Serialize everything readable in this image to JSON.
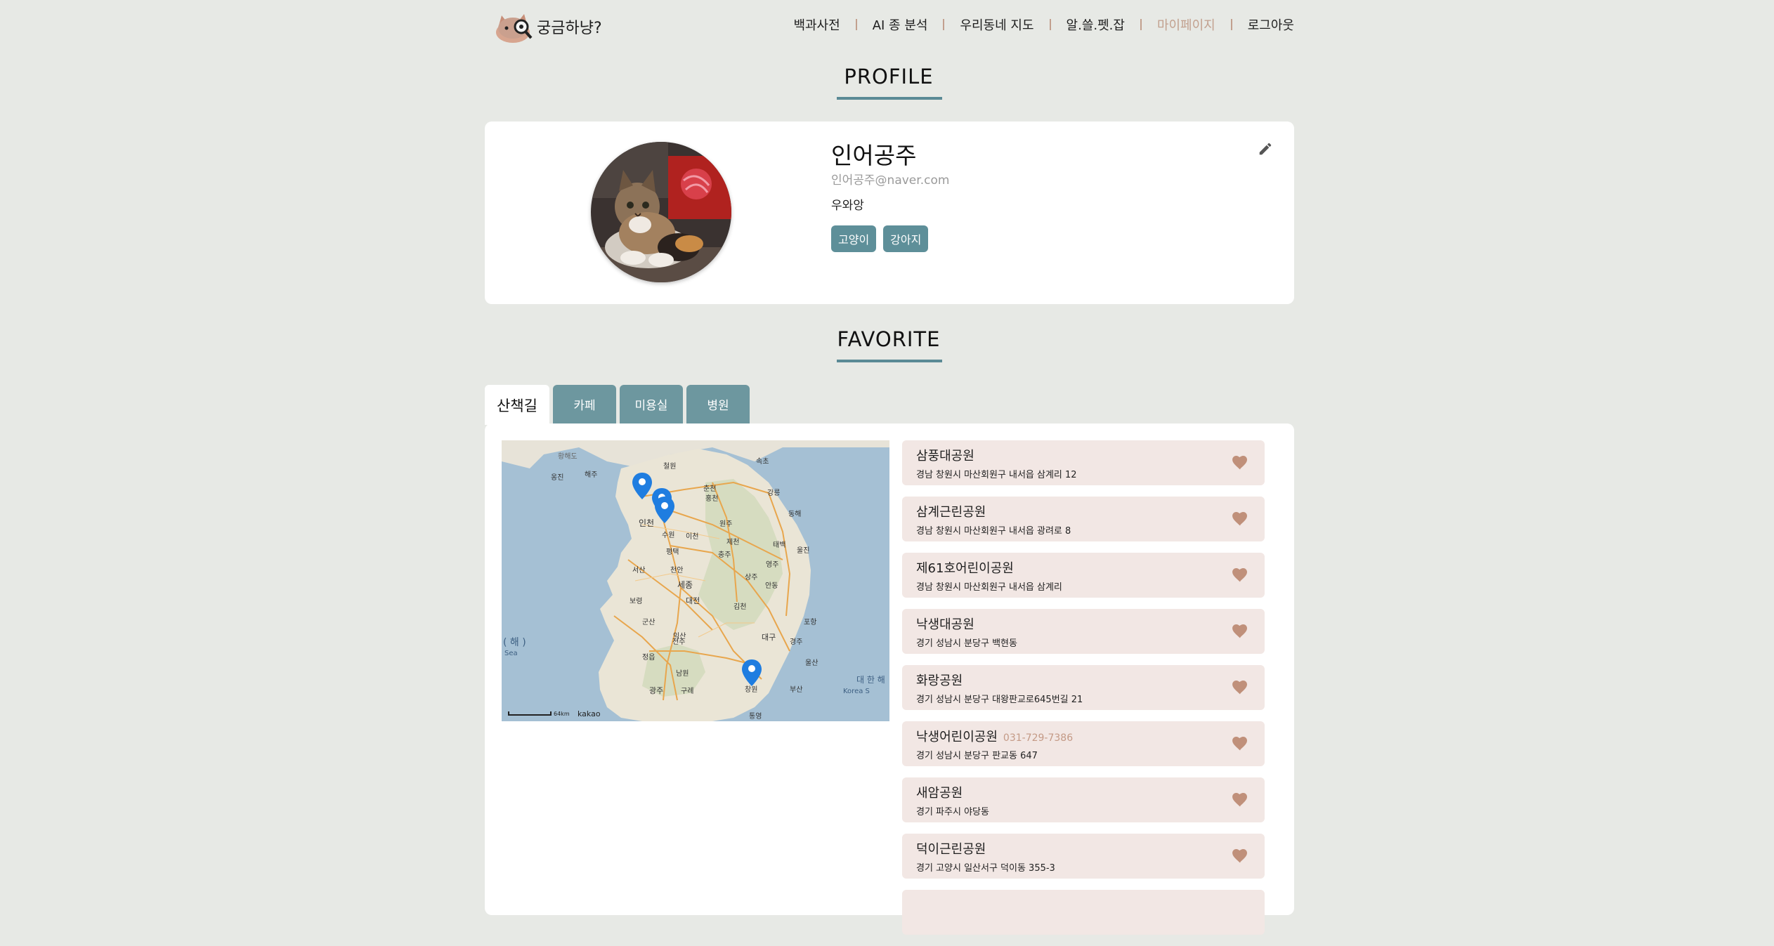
{
  "app": {
    "title": "궁금하냥?"
  },
  "nav": {
    "items": [
      "백과사전",
      "AI 종 분석",
      "우리동네 지도",
      "알.쓸.펫.잡",
      "마이페이지",
      "로그아웃"
    ],
    "active": "마이페이지"
  },
  "profile": {
    "section_title": "PROFILE",
    "name": "인어공주",
    "email": "인어공주@naver.com",
    "bio": "우와앙",
    "tags": [
      "고양이",
      "강아지"
    ]
  },
  "favorite": {
    "section_title": "FAVORITE",
    "tabs": [
      "산책길",
      "카페",
      "미용실",
      "병원"
    ],
    "active_tab": "산책길",
    "map": {
      "labels": [
        "철원",
        "춘천",
        "홍천",
        "속초",
        "강릉",
        "인천",
        "원주",
        "동해",
        "제천",
        "태백",
        "수원",
        "이천",
        "충주",
        "울진",
        "천안",
        "세종",
        "안동",
        "대전",
        "포항",
        "대구",
        "경주",
        "군산",
        "익산",
        "전주",
        "남원",
        "울산",
        "광주",
        "창원",
        "부산",
        "통영",
        "구례",
        "정읍",
        "서산",
        "보령",
        "해주",
        "옹진",
        "황해도",
        "평택",
        "영주",
        "상주",
        "김천",
        "대 한 해",
        "Korea S",
        "( 해 )",
        "Sea",
        "64km",
        "kakao"
      ]
    },
    "places": [
      {
        "name": "삼풍대공원",
        "address": "경남 창원시 마산회원구 내서읍 삼계리 12",
        "phone": ""
      },
      {
        "name": "삼계근린공원",
        "address": "경남 창원시 마산회원구 내서읍 광려로 8",
        "phone": ""
      },
      {
        "name": "제61호어린이공원",
        "address": "경남 창원시 마산회원구 내서읍 삼계리",
        "phone": ""
      },
      {
        "name": "낙생대공원",
        "address": "경기 성남시 분당구 백현동",
        "phone": ""
      },
      {
        "name": "화랑공원",
        "address": "경기 성남시 분당구 대왕판교로645번길 21",
        "phone": ""
      },
      {
        "name": "낙생어린이공원",
        "address": "경기 성남시 분당구 판교동 647",
        "phone": "031-729-7386"
      },
      {
        "name": "새암공원",
        "address": "경기 파주시 야당동",
        "phone": ""
      },
      {
        "name": "덕이근린공원",
        "address": "경기 고양시 일산서구 덕이동 355-3",
        "phone": ""
      }
    ]
  },
  "colors": {
    "background": "#e7e9e5",
    "accent": "#5a8a95",
    "tab": "#6d979f",
    "nav_active": "#c2a08e",
    "place_bg": "#f2e7e4",
    "heart": "#c0907a"
  },
  "icons": {
    "edit": "pencil-icon",
    "favorite": "heart-icon",
    "logo": "cat-magnifier-icon",
    "map_marker": "location-pin-icon"
  }
}
